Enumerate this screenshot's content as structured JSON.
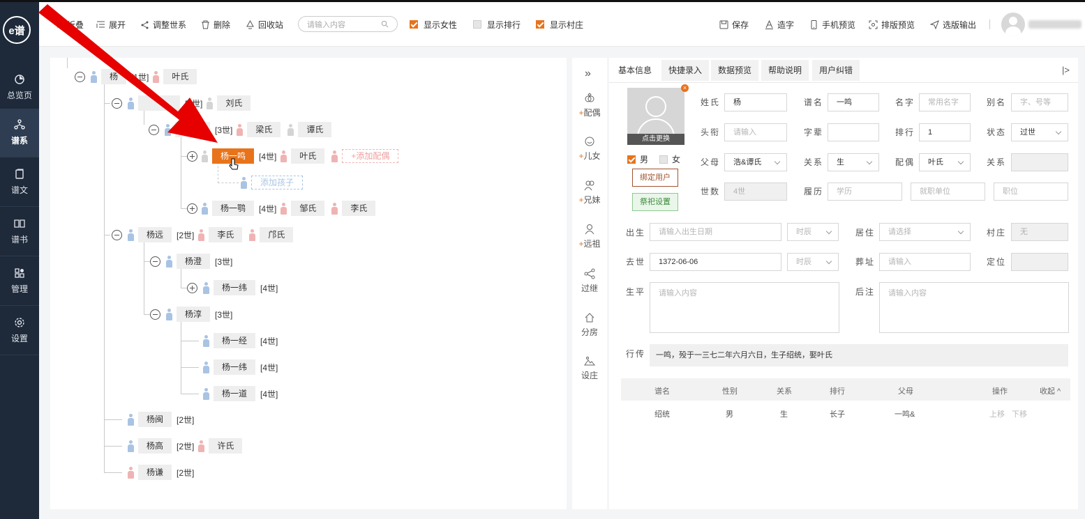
{
  "sidebar": {
    "logo_text": "e谱",
    "items": [
      {
        "label": "总览页",
        "icon": "pie-chart-icon"
      },
      {
        "label": "谱系",
        "icon": "tree-structure-icon",
        "active": true
      },
      {
        "label": "谱文",
        "icon": "document-icon"
      },
      {
        "label": "谱书",
        "icon": "book-icon"
      },
      {
        "label": "管理",
        "icon": "grid-manage-icon"
      },
      {
        "label": "设置",
        "icon": "gear-icon"
      }
    ]
  },
  "toolbar": {
    "collapse": "折叠",
    "expand": "展开",
    "adjust": "调整世系",
    "delete": "删除",
    "recycle": "回收站",
    "search_placeholder": "请输入内容",
    "show_female": "显示女性",
    "show_rank": "显示排行",
    "show_village": "显示村庄",
    "save": "保存",
    "make_char": "造字",
    "mobile_preview": "手机预览",
    "layout_preview": "排版预览",
    "export": "选版输出",
    "phone": "13672456185"
  },
  "tree": {
    "root": {
      "name": "杨",
      "gen": "[1世]",
      "spouses": [
        "叶氏"
      ]
    },
    "n_liu": {
      "gen": "[2世]",
      "spouses": [
        "刘氏"
      ]
    },
    "n_3": {
      "gen": "[3世]",
      "spouses": [
        "梁氏",
        "谭氏"
      ]
    },
    "sel": {
      "name": "杨一鸣",
      "gen": "[4世]",
      "spouses": [
        "叶氏"
      ],
      "add_spouse": "+添加配偶"
    },
    "add_child": "添加孩子",
    "yi_e": {
      "name": "杨一鹗",
      "gen": "[4世]",
      "spouses": [
        "邹氏",
        "李氏"
      ]
    },
    "yang_yuan": {
      "name": "杨远",
      "gen": "[2世]",
      "spouses": [
        "李氏",
        "邝氏"
      ]
    },
    "yang_cheng": {
      "name": "杨澄",
      "gen": "[3世]"
    },
    "yi_wei1": {
      "name": "杨一纬",
      "gen": "[4世]"
    },
    "yang_chun": {
      "name": "杨淳",
      "gen": "[3世]"
    },
    "yi_jing": {
      "name": "杨一经",
      "gen": "[4世]"
    },
    "yi_wei2": {
      "name": "杨一纬",
      "gen": "[4世]"
    },
    "yi_dao": {
      "name": "杨一道",
      "gen": "[4世]"
    },
    "yang_min": {
      "name": "杨闽",
      "gen": "[2世]"
    },
    "yang_gao": {
      "name": "杨高",
      "gen": "[2世]",
      "spouses": [
        "许氏"
      ]
    },
    "yang_qian": {
      "name": "杨谦",
      "gen": "[2世]"
    }
  },
  "tools": [
    {
      "label": "配偶",
      "plus": "+",
      "icon": "heart-rings-icon"
    },
    {
      "label": "儿女",
      "plus": "+",
      "icon": "baby-icon"
    },
    {
      "label": "兄妹",
      "plus": "+",
      "icon": "siblings-icon"
    },
    {
      "label": "远祖",
      "plus": "+",
      "icon": "ancestor-icon"
    },
    {
      "label": "过继",
      "plus": "",
      "icon": "share-icon"
    },
    {
      "label": "分房",
      "plus": "",
      "icon": "house-icon"
    },
    {
      "label": "设庄",
      "plus": "",
      "icon": "village-icon"
    }
  ],
  "tabs": [
    "基本信息",
    "快捷录入",
    "数据预览",
    "帮助说明",
    "用户纠错"
  ],
  "detail": {
    "photo_caption": "点击更换",
    "gender_male": "男",
    "gender_female": "女",
    "bind_user": "绑定用户",
    "sacrifice": "祭祀设置",
    "surname_label": "姓氏",
    "surname": "杨",
    "puming_label": "谱名",
    "puming": "一鸣",
    "name_label": "名字",
    "name_ph": "常用名字",
    "alias_label": "别名",
    "alias_ph": "字、号等",
    "title_label": "头衔",
    "title_ph": "请输入",
    "zibei_label": "字辈",
    "rank_label": "排行",
    "rank": "1",
    "status_label": "状态",
    "status": "过世",
    "parents_label": "父母",
    "parents": "浩&谭氏",
    "relation_label": "关系",
    "relation": "生",
    "spouse_label": "配偶",
    "spouse": "叶氏",
    "relation2_label": "关系",
    "gen_label": "世数",
    "gen": "4世",
    "resume_label": "履历",
    "edu_ph": "学历",
    "work_ph": "就职单位",
    "pos_ph": "职位",
    "birth_label": "出生",
    "birth_ph": "请输入出生日期",
    "shichen": "时辰",
    "live_label": "居住",
    "live_ph": "请选择",
    "village_label": "村庄",
    "village": "无",
    "death_label": "去世",
    "death": "1372-06-06",
    "burial_label": "葬址",
    "burial_ph": "请输入",
    "locate_label": "定位",
    "life_label": "生平",
    "life_ph": "请输入内容",
    "note_label": "后注",
    "note_ph": "请输入内容",
    "bio_label": "行传",
    "bio": "一鸣，殁于一三七二年六月六日，生子绍统，娶叶氏"
  },
  "children_table": {
    "headers": [
      "谱名",
      "性别",
      "关系",
      "排行",
      "父母",
      "操作",
      "收起"
    ],
    "rows": [
      {
        "name": "绍统",
        "gender": "男",
        "relation": "生",
        "rank": "长子",
        "parents": "一鸣&",
        "up": "上移",
        "down": "下移"
      }
    ]
  },
  "colors": {
    "accent": "#e8731a",
    "sidebar": "#1e2a3a",
    "annotation_arrow": "#e60000"
  }
}
